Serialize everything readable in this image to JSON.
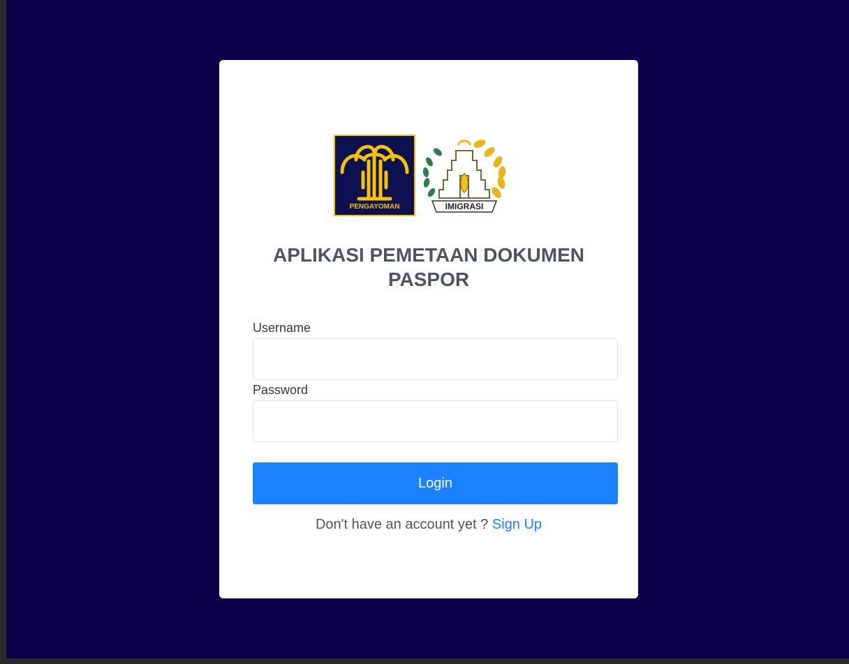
{
  "app": {
    "title": "APLIKASI PEMETAAN DOKUMEN PASPOR"
  },
  "logos": {
    "left_name": "pengayoman-logo",
    "left_text": "PENGAYOMAN",
    "right_name": "imigrasi-logo",
    "right_text": "IMIGRASI"
  },
  "form": {
    "username_label": "Username",
    "username_value": "",
    "password_label": "Password",
    "password_value": "",
    "login_label": "Login"
  },
  "signup": {
    "prompt": "Don't have an account yet ?",
    "link_label": "Sign Up"
  },
  "colors": {
    "background": "#0d004a",
    "primary": "#1a82ff",
    "gold": "#f4c20d",
    "title": "#50555d"
  }
}
